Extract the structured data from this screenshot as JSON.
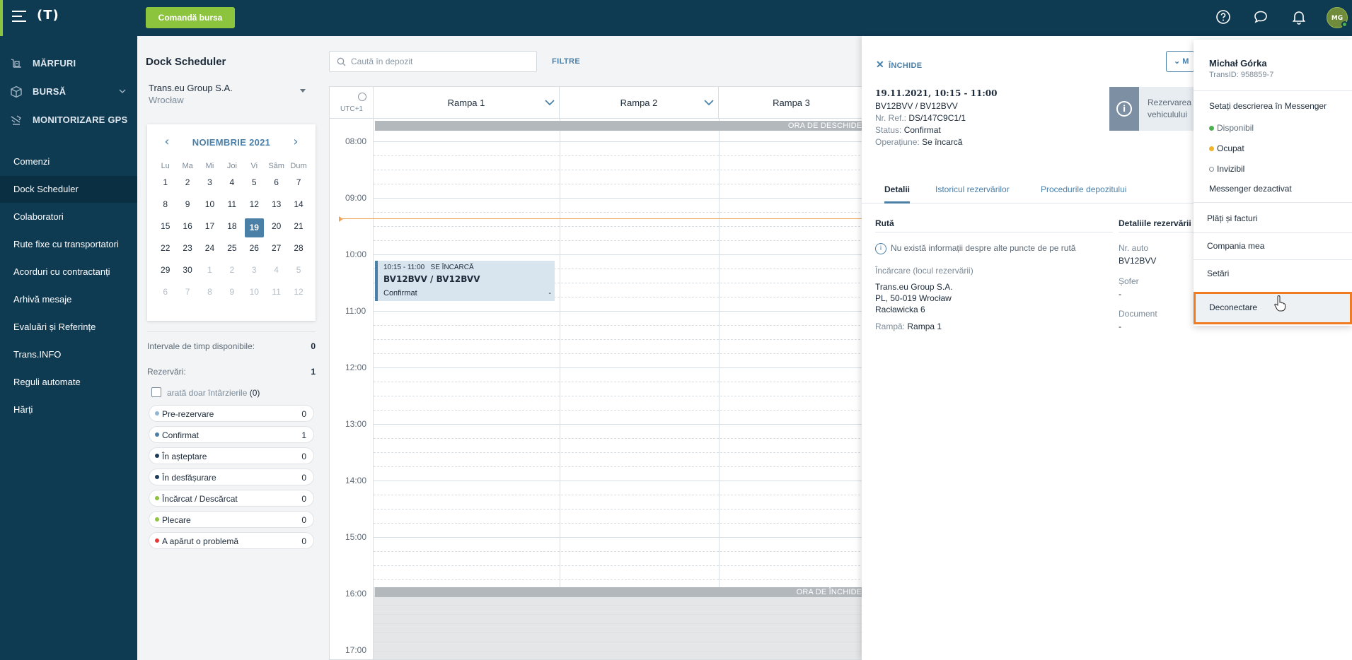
{
  "topbar": {
    "logo": "(T)",
    "order_button": "Comandă bursa",
    "avatar_initials": "MG",
    "accent_color": "#8cc43d"
  },
  "sidebar": {
    "main": [
      {
        "label": "MĂRFURI",
        "icon": "boxes-icon"
      },
      {
        "label": "BURSĂ",
        "icon": "cube-icon"
      },
      {
        "label": "MONITORIZARE GPS",
        "icon": "truck-gps-icon"
      }
    ],
    "items": [
      {
        "label": "Comenzi"
      },
      {
        "label": "Dock Scheduler",
        "active": true
      },
      {
        "label": "Colaboratori"
      },
      {
        "label": "Rute fixe cu transportatori"
      },
      {
        "label": "Acorduri cu contractanți"
      },
      {
        "label": "Arhivă mesaje"
      },
      {
        "label": "Evaluări și Referințe"
      },
      {
        "label": "Trans.INFO"
      },
      {
        "label": "Reguli automate"
      },
      {
        "label": "Hărți"
      }
    ]
  },
  "left": {
    "title": "Dock Scheduler",
    "company": "Trans.eu Group S.A.",
    "city": "Wrocław",
    "calendar": {
      "month": "NOIEMBRIE 2021",
      "dow": [
        "Lu",
        "Ma",
        "Mi",
        "Joi",
        "Vi",
        "Sâm",
        "Dum"
      ],
      "rows": [
        [
          "1",
          "2",
          "3",
          "4",
          "5",
          "6",
          "7"
        ],
        [
          "8",
          "9",
          "10",
          "11",
          "12",
          "13",
          "14"
        ],
        [
          "15",
          "16",
          "17",
          "18",
          "19",
          "20",
          "21"
        ],
        [
          "22",
          "23",
          "24",
          "25",
          "26",
          "27",
          "28"
        ],
        [
          "29",
          "30",
          "1",
          "2",
          "3",
          "4",
          "5"
        ],
        [
          "6",
          "7",
          "8",
          "9",
          "10",
          "11",
          "12"
        ]
      ],
      "selected": "19"
    },
    "intervals_label": "Intervale de timp disponibile:",
    "intervals_value": "0",
    "bookings_label": "Rezervări:",
    "bookings_value": "1",
    "late_only_label": "arată doar întârzierile",
    "late_only_count": "(0)",
    "statuses": [
      {
        "label": "Pre-rezervare",
        "count": "0",
        "color": "#8fb5d3"
      },
      {
        "label": "Confirmat",
        "count": "1",
        "color": "#4a7fa8"
      },
      {
        "label": "În așteptare",
        "count": "0",
        "color": "#1d3c5a"
      },
      {
        "label": "În desfășurare",
        "count": "0",
        "color": "#1d3c5a"
      },
      {
        "label": "Încărcat / Descărcat",
        "count": "0",
        "color": "#8cc43d"
      },
      {
        "label": "Plecare",
        "count": "0",
        "color": "#8cc43d"
      },
      {
        "label": "A apărut o problemă",
        "count": "0",
        "color": "#e53935"
      }
    ]
  },
  "search": {
    "placeholder": "Caută în depozit",
    "value": ""
  },
  "filters_label": "FILTRE",
  "scheduler": {
    "timezone": "UTC+1",
    "ramps": [
      "Rampa 1",
      "Rampa 2",
      "Rampa 3"
    ],
    "hours": [
      "08:00",
      "09:00",
      "10:00",
      "11:00",
      "12:00",
      "13:00",
      "14:00",
      "15:00",
      "16:00",
      "17:00"
    ],
    "opening_label": "ORA DE DESCHIDERE",
    "closing_label": "ORA DE ÎNCHIDERE",
    "booking": {
      "time": "10:15 - 11:00",
      "op": "SE ÎNCARCĂ",
      "plates": "BV12BVV / BV12BVV",
      "status": "Confirmat",
      "extra": "-"
    }
  },
  "detail": {
    "close_label": "ÎNCHIDE",
    "m_label": "M",
    "title": "19.11.2021, 10:15 - 11:00",
    "plates": "BV12BVV / BV12BVV",
    "ref_key": "Nr. Ref.:",
    "ref_val": "DS/147C9C1/1",
    "status_key": "Status:",
    "status_val": "Confirmat",
    "op_key": "Operațiune:",
    "op_val": "Se încarcă",
    "info_card": [
      "Rezervarea",
      "vehiculului"
    ],
    "tabs": [
      "Detalii",
      "Istoricul rezervărilor",
      "Procedurile depozitului"
    ],
    "route_title": "Rută",
    "route_info": "Nu există informații despre alte puncte de pe rută",
    "loading_label": "Încărcare (locul rezervării)",
    "address": [
      "Trans.eu Group S.A.",
      "PL, 50-019 Wrocław",
      "Racławicka 6"
    ],
    "ramp_key": "Rampă:",
    "ramp_val": "Rampa 1",
    "booking_details_title": "Detaliile rezervării",
    "plate_key": "Nr. auto",
    "plate_val": "BV12BVV",
    "driver_key": "Șofer",
    "driver_val": "-",
    "document_key": "Document",
    "document_val": "-"
  },
  "user_menu": {
    "name": "Michał Górka",
    "trans_id": "TransID: 958859-7",
    "messenger_setup": "Setați descrierea în Messenger",
    "statuses": [
      {
        "label": "Disponibil",
        "color": "#4caf50"
      },
      {
        "label": "Ocupat",
        "color": "#f0b429"
      },
      {
        "label": "Invizibil",
        "color": "#ffffff"
      }
    ],
    "messenger_off": "Messenger dezactivat",
    "payments": "Plăți și facturi",
    "company": "Compania mea",
    "settings": "Setări",
    "logout": "Deconectare",
    "highlight_color": "#f07b20"
  }
}
